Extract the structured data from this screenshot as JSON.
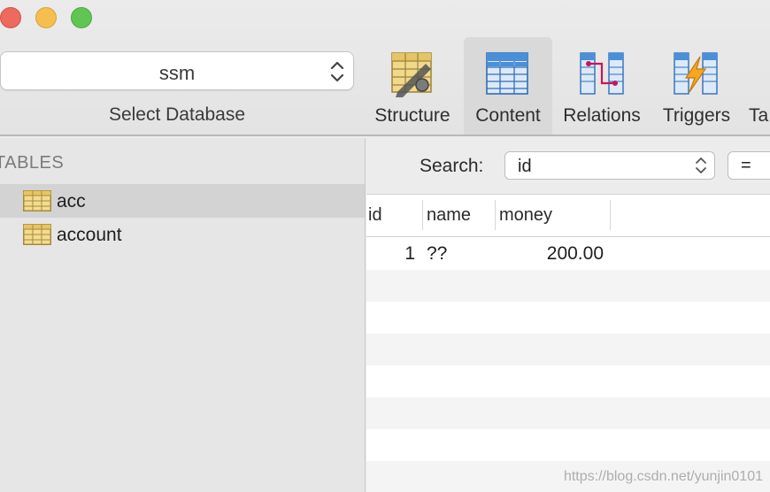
{
  "window": {
    "controls": [
      "close",
      "minimize",
      "maximize"
    ]
  },
  "toolbar": {
    "database": {
      "value": "ssm",
      "label": "Select Database"
    },
    "tools": [
      {
        "label": "Structure",
        "icon": "structure-icon",
        "selected": false
      },
      {
        "label": "Content",
        "icon": "content-icon",
        "selected": true
      },
      {
        "label": "Relations",
        "icon": "relations-icon",
        "selected": false
      },
      {
        "label": "Triggers",
        "icon": "triggers-icon",
        "selected": false
      },
      {
        "label": "Ta",
        "icon": "",
        "selected": false
      }
    ]
  },
  "sidebar": {
    "header": "TABLES",
    "tables": [
      {
        "name": "acc",
        "selected": true
      },
      {
        "name": "account",
        "selected": false
      }
    ]
  },
  "filter": {
    "label": "Search:",
    "field": "id",
    "operator": "="
  },
  "grid": {
    "columns": [
      "id",
      "name",
      "money"
    ],
    "rows": [
      [
        "1",
        "??",
        "200.00"
      ]
    ]
  },
  "watermark": "https://blog.csdn.net/yunjin0101",
  "colors": {
    "toolbar_bg": "#e3e3e3",
    "sidebar_bg": "#e6e6e6",
    "selection_bg": "#d3d3d3",
    "row_alt": "#f4f4f4",
    "close": "#ed6a5e",
    "minimize": "#f5bf4f",
    "maximize": "#61c554"
  }
}
